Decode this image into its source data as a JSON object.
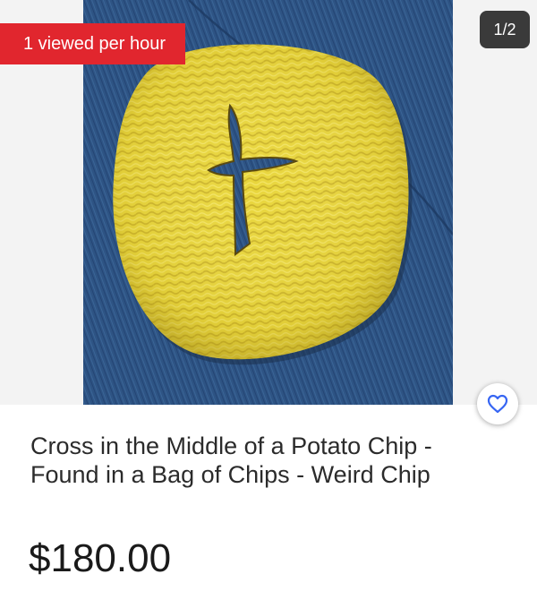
{
  "listing": {
    "viewed_badge": "1 viewed per hour",
    "image_counter": "1/2",
    "title": "Cross in the Middle of a Potato Chip - Found in a Bag of Chips - Weird Chip",
    "price": "$180.00"
  },
  "icons": {
    "favorite": "heart-outline-icon"
  },
  "colors": {
    "badge_red": "#e1262e",
    "counter_bg": "#3a3a3a",
    "heart_blue": "#3665f3",
    "fabric_blue": "#2e5484",
    "chip_yellow": "#e8d43a"
  }
}
